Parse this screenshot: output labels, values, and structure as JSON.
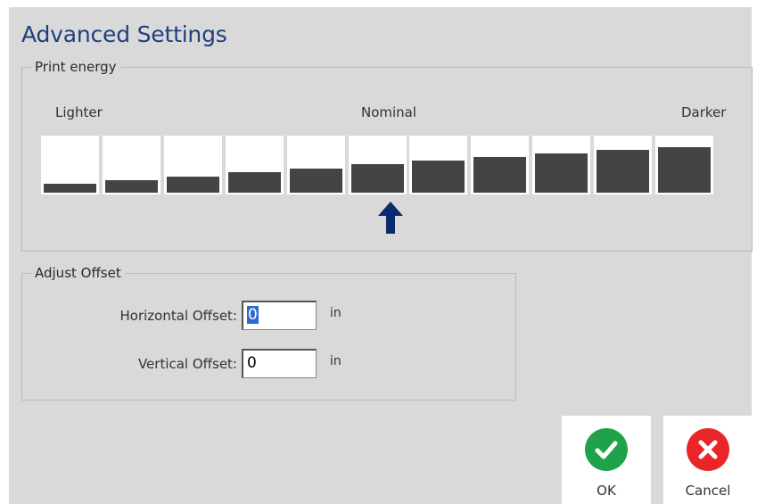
{
  "dialog": {
    "title": "Advanced Settings"
  },
  "print_energy": {
    "legend": "Print energy",
    "label_left": "Lighter",
    "label_center": "Nominal",
    "label_right": "Darker",
    "levels": [
      1,
      2,
      3,
      4,
      5,
      6,
      7,
      8,
      9,
      10,
      11
    ],
    "selected_level": 6,
    "fill_fractions": [
      0.15,
      0.21,
      0.28,
      0.35,
      0.41,
      0.48,
      0.54,
      0.61,
      0.66,
      0.72,
      0.78
    ]
  },
  "adjust_offset": {
    "legend": "Adjust Offset",
    "horizontal_label": "Horizontal Offset:",
    "horizontal_value": "0",
    "vertical_label": "Vertical Offset:",
    "vertical_value": "0",
    "unit": "in"
  },
  "buttons": {
    "ok_label": "OK",
    "cancel_label": "Cancel",
    "ok_color": "#1fa34a",
    "cancel_color": "#e8262a"
  },
  "colors": {
    "title": "#1f3f7f",
    "bar_fill": "#444444",
    "arrow": "#0b2a6e"
  }
}
